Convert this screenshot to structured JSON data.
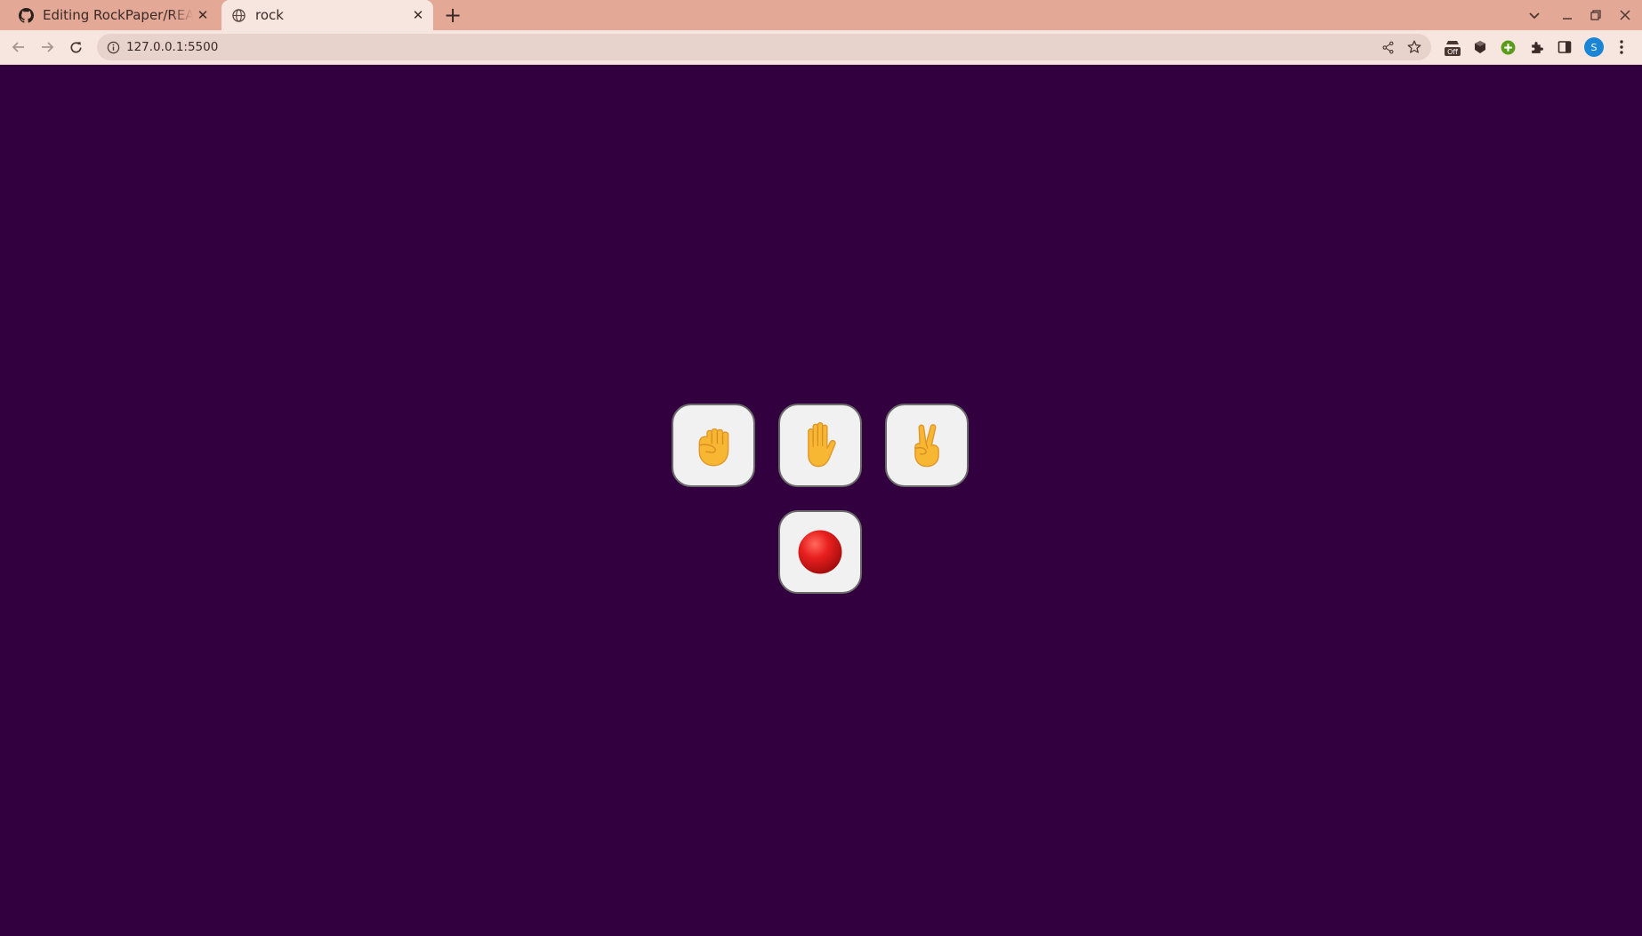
{
  "browser": {
    "tabs": [
      {
        "title": "Editing RockPaper/README.md",
        "active": false,
        "favicon": "github-icon"
      },
      {
        "title": "rock",
        "active": true,
        "favicon": "globe-icon"
      }
    ],
    "address": {
      "url": "127.0.0.1:5500"
    },
    "profile": {
      "initial": "S",
      "color": "#1a84d6"
    }
  },
  "theme": {
    "page_background": "#33003f",
    "button_background": "#f1f1f1",
    "emoji_yellow": "#f7b733",
    "record_red": "#e8201e"
  },
  "game": {
    "choices": [
      {
        "name": "rock",
        "icon": "raised-fist-icon"
      },
      {
        "name": "paper",
        "icon": "raised-hand-icon"
      },
      {
        "name": "scissors",
        "icon": "victory-hand-icon"
      }
    ],
    "action": {
      "name": "record",
      "icon": "red-circle-icon"
    }
  }
}
